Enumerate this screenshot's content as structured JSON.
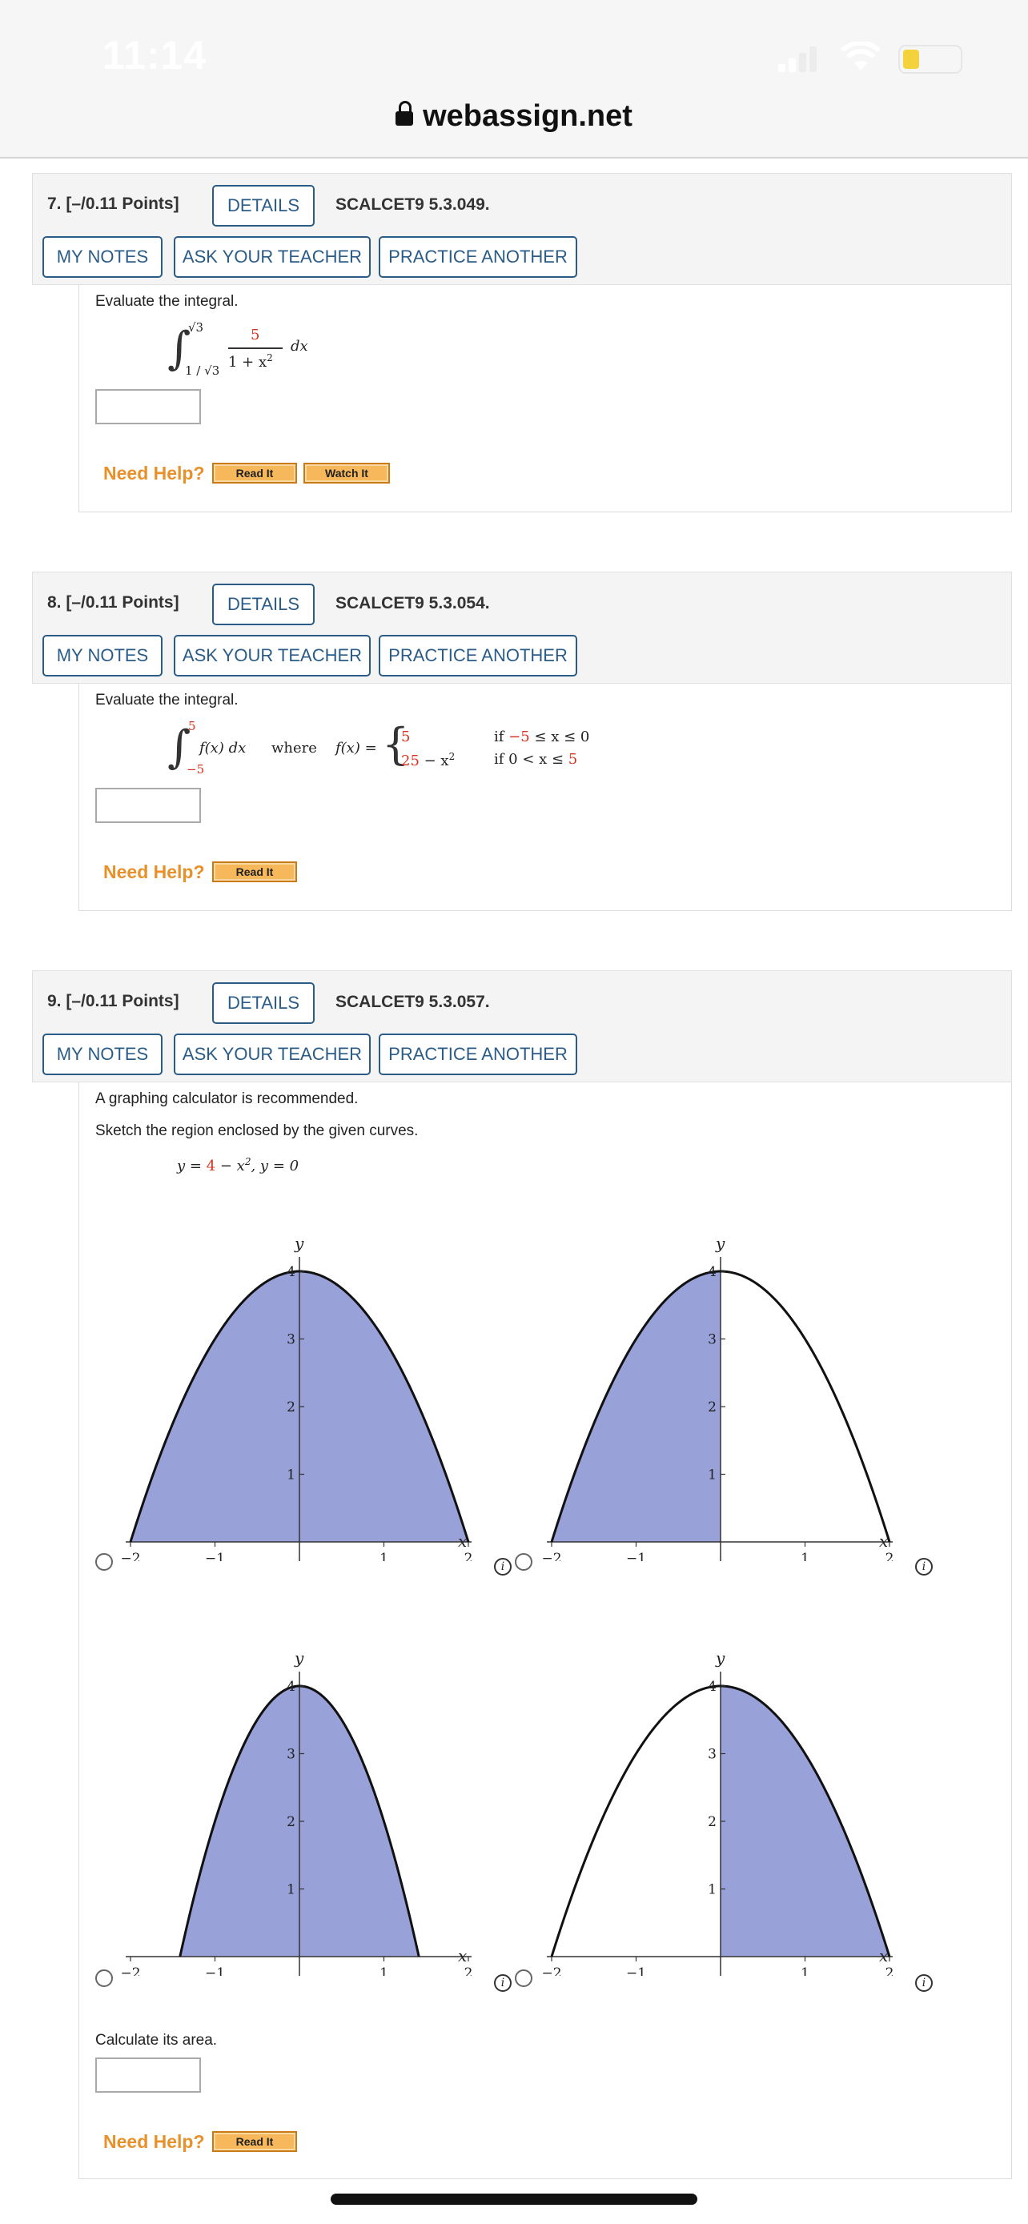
{
  "status": {
    "time": "11:14"
  },
  "browser": {
    "url": "webassign.net"
  },
  "buttons": {
    "details": "DETAILS",
    "my_notes": "MY NOTES",
    "ask_teacher": "ASK YOUR TEACHER",
    "practice": "PRACTICE ANOTHER"
  },
  "help": {
    "label": "Need Help?",
    "read_it": "Read It",
    "watch_it": "Watch It"
  },
  "q7": {
    "header": "7.  [–/0.11 Points]",
    "code": "SCALCET9 5.3.049.",
    "prompt": "Evaluate the integral.",
    "upper": "√3",
    "lower": "1 / √3",
    "numerator": "5",
    "denominator": "1 + x",
    "denominator_exp": "2",
    "dx": "dx"
  },
  "q8": {
    "header": "8.  [–/0.11 Points]",
    "code": "SCALCET9 5.3.054.",
    "prompt": "Evaluate the integral.",
    "upper": "5",
    "lower": "−5",
    "integrand": "f(x) dx",
    "where": "where",
    "fx": "f(x) =",
    "case1_value": "5",
    "case1_cond_a": "if ",
    "case1_cond_b": "−5",
    "case1_cond_c": " ≤ x ≤ 0",
    "case2_value_a": "25",
    "case2_value_b": " − x",
    "case2_exp": "2",
    "case2_cond_a": "if   0 < x ≤ ",
    "case2_cond_b": "5"
  },
  "q9": {
    "header": "9.  [–/0.11 Points]",
    "code": "SCALCET9 5.3.057.",
    "recommend": "A graphing calculator is recommended.",
    "prompt": "Sketch the region enclosed by the given curves.",
    "eq_a": "y = ",
    "eq_b": "4",
    "eq_c": " − x",
    "eq_exp": "2",
    "eq_d": ",    y = 0",
    "area_prompt": "Calculate its area."
  },
  "chart_data": [
    {
      "type": "area",
      "curve": "y = 4 - x^2",
      "shaded": "between curve and y = 0, x from -2 to 2",
      "xlim": [
        -2,
        2
      ],
      "ylim": [
        0,
        4
      ],
      "x_ticks": [
        "−2",
        "−1",
        "1",
        "2"
      ],
      "y_ticks": [
        "1",
        "2",
        "3",
        "4"
      ],
      "xlabel": "x",
      "ylabel": "y",
      "fill": "#98a2d9"
    },
    {
      "type": "area",
      "curve": "y = 4 - x^2",
      "shaded": "x from -2 to 0",
      "xlim": [
        -2,
        2
      ],
      "ylim": [
        0,
        4
      ],
      "x_ticks": [
        "−2",
        "−1",
        "1",
        "2"
      ],
      "y_ticks": [
        "1",
        "2",
        "3",
        "4"
      ],
      "xlabel": "x",
      "ylabel": "y",
      "fill": "#98a2d9"
    },
    {
      "type": "area",
      "curve": "narrower parabola, vertex (0, 4), x-intercepts near ±1.4",
      "shaded": "between curve and y = 0",
      "xlim": [
        -2,
        2
      ],
      "ylim": [
        0,
        4
      ],
      "x_ticks": [
        "−2",
        "−1",
        "1",
        "2"
      ],
      "y_ticks": [
        "1",
        "2",
        "3",
        "4"
      ],
      "xlabel": "x",
      "ylabel": "y",
      "fill": "#98a2d9"
    },
    {
      "type": "area",
      "curve": "y = 4 - x^2",
      "shaded": "x from 0 to 2",
      "xlim": [
        -2,
        2
      ],
      "ylim": [
        0,
        4
      ],
      "x_ticks": [
        "−2",
        "−1",
        "1",
        "2"
      ],
      "y_ticks": [
        "1",
        "2",
        "3",
        "4"
      ],
      "xlabel": "x",
      "ylabel": "y",
      "fill": "#98a2d9"
    }
  ]
}
